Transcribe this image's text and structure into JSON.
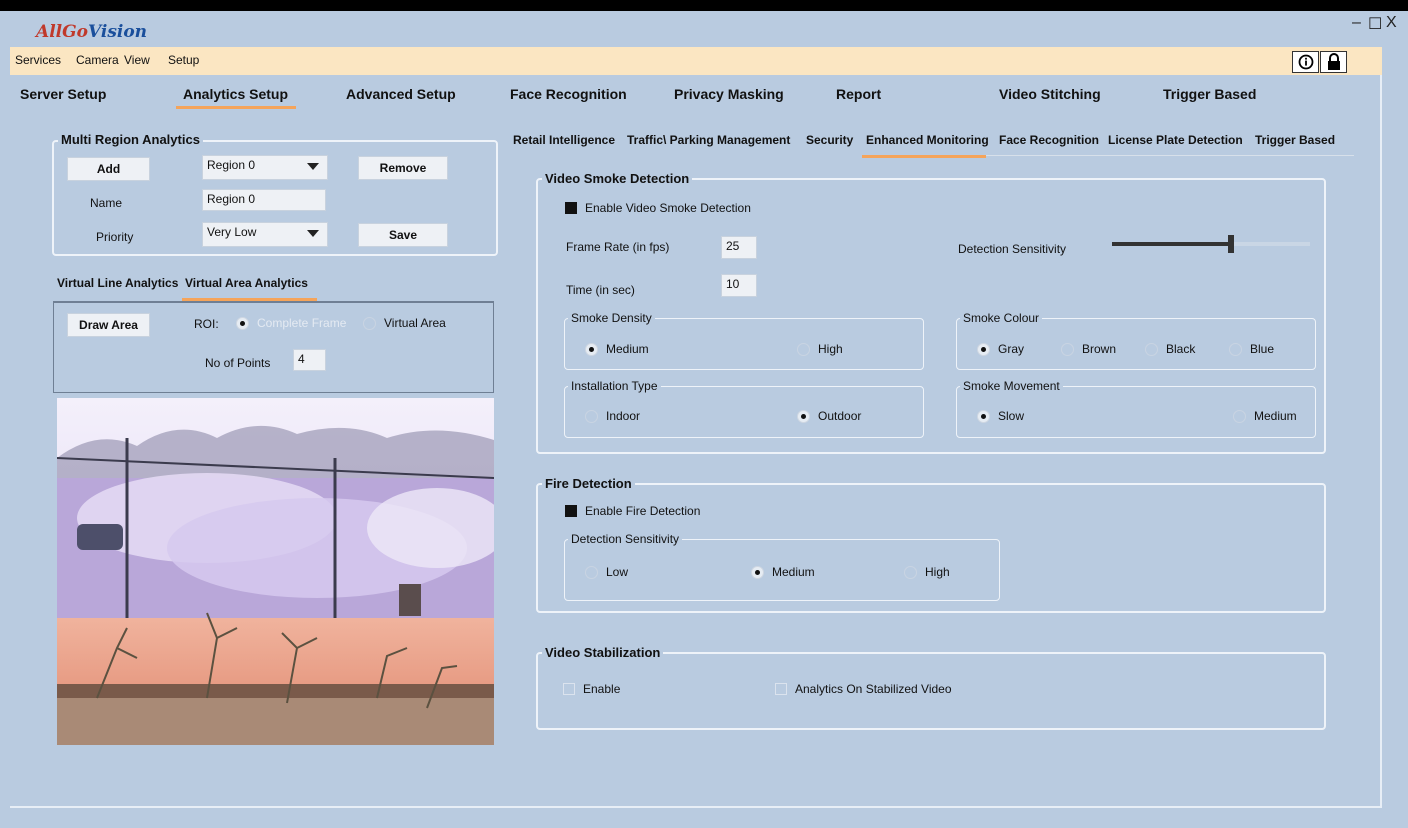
{
  "app": {
    "logo_part1": "AllGo",
    "logo_part2": "Vision",
    "minimize": "–",
    "maximize": "☐",
    "close": "X"
  },
  "menu": [
    "Services",
    "Camera",
    "View",
    "Setup"
  ],
  "main_tabs": [
    "Server Setup",
    "Analytics Setup",
    "Advanced Setup",
    "Face Recognition",
    "Privacy Masking",
    "Report",
    "Video Stitching",
    "Trigger Based"
  ],
  "multi_region": {
    "title": "Multi Region Analytics",
    "add": "Add",
    "remove": "Remove",
    "save": "Save",
    "region_select": "Region 0",
    "name_label": "Name",
    "name_value": "Region 0",
    "priority_label": "Priority",
    "priority_value": "Very Low"
  },
  "virtual_tabs": [
    "Virtual Line Analytics",
    "Virtual Area Analytics"
  ],
  "virtual_area": {
    "draw_area": "Draw Area",
    "roi_label": "ROI:",
    "complete_frame": "Complete Frame",
    "virtual_area": "Virtual Area",
    "points_label": "No of Points",
    "points_value": "4"
  },
  "sub_tabs": [
    "Retail Intelligence",
    "Traffic\\ Parking Management",
    "Security",
    "Enhanced Monitoring",
    "Face Recognition",
    "License Plate Detection",
    "Trigger Based"
  ],
  "smoke": {
    "title": "Video Smoke Detection",
    "enable": "Enable Video Smoke Detection",
    "frame_rate_label": "Frame Rate (in fps)",
    "frame_rate": "25",
    "time_label": "Time (in sec)",
    "time": "10",
    "sensitivity_label": "Detection Sensitivity",
    "sensitivity_level": 0.6,
    "density_title": "Smoke Density",
    "density_medium": "Medium",
    "density_high": "High",
    "colour_title": "Smoke Colour",
    "colour_gray": "Gray",
    "colour_brown": "Brown",
    "colour_black": "Black",
    "colour_blue": "Blue",
    "install_title": "Installation Type",
    "install_indoor": "Indoor",
    "install_outdoor": "Outdoor",
    "movement_title": "Smoke Movement",
    "movement_slow": "Slow",
    "movement_medium": "Medium"
  },
  "fire": {
    "title": "Fire Detection",
    "enable": "Enable Fire Detection",
    "sens_title": "Detection Sensitivity",
    "low": "Low",
    "medium": "Medium",
    "high": "High"
  },
  "stabilization": {
    "title": "Video Stabilization",
    "enable": "Enable",
    "analytics": "Analytics On Stabilized Video"
  }
}
